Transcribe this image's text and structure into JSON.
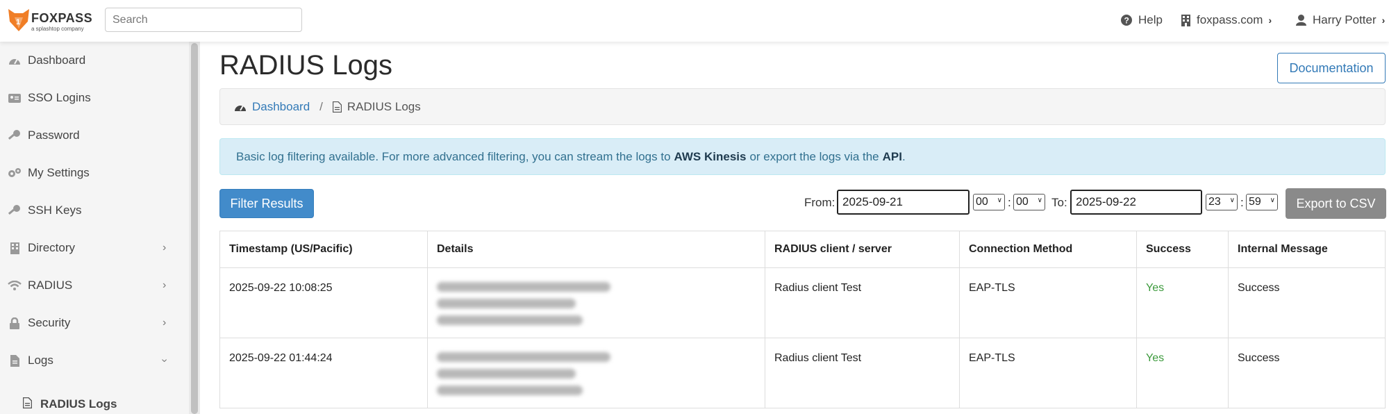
{
  "header": {
    "brand": "FOXPASS",
    "brand_sub": "a splashtop company",
    "search_placeholder": "Search",
    "help_label": "Help",
    "org_label": "foxpass.com",
    "user_label": "Harry Potter"
  },
  "sidebar": {
    "items": [
      {
        "label": "Dashboard",
        "icon": "dashboard-icon"
      },
      {
        "label": "SSO Logins",
        "icon": "id-card-icon"
      },
      {
        "label": "Password",
        "icon": "key-icon"
      },
      {
        "label": "My Settings",
        "icon": "gears-icon"
      },
      {
        "label": "SSH Keys",
        "icon": "key-icon"
      },
      {
        "label": "Directory",
        "icon": "building-icon"
      },
      {
        "label": "RADIUS",
        "icon": "wifi-icon"
      },
      {
        "label": "Security",
        "icon": "lock-icon"
      },
      {
        "label": "Logs",
        "icon": "file-icon"
      }
    ],
    "sub_item": {
      "label": "RADIUS Logs",
      "icon": "file-text-icon"
    }
  },
  "main": {
    "title": "RADIUS Logs",
    "doc_button": "Documentation",
    "breadcrumb": {
      "home": "Dashboard",
      "separator": "/",
      "current": "RADIUS Logs"
    },
    "alert": {
      "pre": "Basic log filtering available. For more advanced filtering, you can stream the logs to",
      "kinesis": "AWS Kinesis",
      "mid": "or export the logs via the",
      "api": "API",
      "post": "."
    },
    "filter_button": "Filter Results",
    "from_label": "From:",
    "from_date": "2025-09-21",
    "from_hour": "00",
    "from_minute": "00",
    "to_label": "To:",
    "to_date": "2025-09-22",
    "to_hour": "23",
    "to_minute": "59",
    "colon": ":",
    "export_button": "Export to CSV"
  },
  "table": {
    "columns": [
      "Timestamp (US/Pacific)",
      "Details",
      "RADIUS client / server",
      "Connection Method",
      "Success",
      "Internal Message"
    ],
    "rows": [
      {
        "timestamp": "2025-09-22 10:08:25",
        "client": "Radius client Test",
        "method": "EAP-TLS",
        "success": "Yes",
        "message": "Success"
      },
      {
        "timestamp": "2025-09-22 01:44:24",
        "client": "Radius client Test",
        "method": "EAP-TLS",
        "success": "Yes",
        "message": "Success"
      }
    ]
  },
  "colors": {
    "accent": "#337ab7",
    "success": "#3c9a3c",
    "alert_bg": "#d9edf7",
    "button_primary": "#428bca",
    "button_grey": "#8a8a8a",
    "fox_orange": "#f07e26"
  }
}
